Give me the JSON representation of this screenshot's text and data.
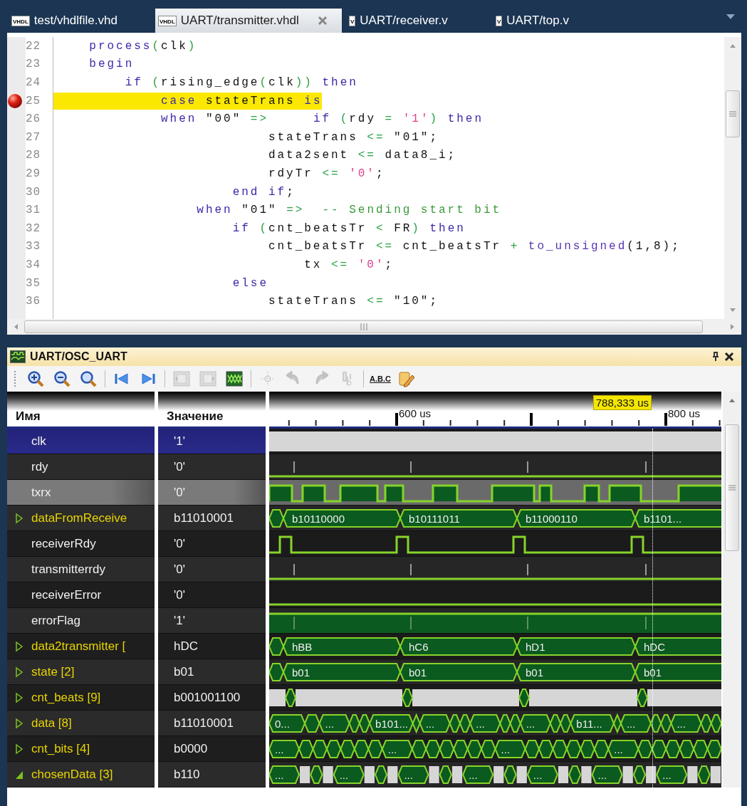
{
  "tabs": [
    {
      "label": "test/vhdlfile.vhd",
      "icon_label": "VHDL",
      "selected": false
    },
    {
      "label": "UART/transmitter.vhdl",
      "icon_label": "VHDL",
      "selected": true
    },
    {
      "label": "UART/receiver.v",
      "icon_label": "V",
      "selected": false
    },
    {
      "label": "UART/top.v",
      "icon_label": "V",
      "selected": false
    }
  ],
  "editor": {
    "lines": [
      {
        "number": "22",
        "breakpoint": false,
        "current": false,
        "tokens": [
          {
            "t": "    process",
            "kind": "kw"
          },
          {
            "t": "(",
            "kind": "op"
          },
          {
            "t": "clk",
            "kind": "id"
          },
          {
            "t": ")",
            "kind": "op"
          }
        ]
      },
      {
        "number": "23",
        "breakpoint": false,
        "current": false,
        "tokens": [
          {
            "t": "    begin",
            "kind": "kw"
          }
        ]
      },
      {
        "number": "24",
        "breakpoint": false,
        "current": false,
        "tokens": [
          {
            "t": "        if ",
            "kind": "kw"
          },
          {
            "t": "(",
            "kind": "op"
          },
          {
            "t": "rising_edge",
            "kind": "id"
          },
          {
            "t": "(",
            "kind": "op"
          },
          {
            "t": "clk",
            "kind": "id"
          },
          {
            "t": ")) ",
            "kind": "op"
          },
          {
            "t": "then",
            "kind": "kw"
          }
        ]
      },
      {
        "number": "25",
        "breakpoint": true,
        "current": true,
        "tokens": [
          {
            "t": "            case ",
            "kind": "kw"
          },
          {
            "t": "stateTrans ",
            "kind": "id"
          },
          {
            "t": "is",
            "kind": "kw"
          }
        ]
      },
      {
        "number": "26",
        "breakpoint": false,
        "current": false,
        "tokens": [
          {
            "t": "            when ",
            "kind": "kw"
          },
          {
            "t": "\"00\" ",
            "kind": "str"
          },
          {
            "t": "=>",
            "kind": "op"
          },
          {
            "t": "     if ",
            "kind": "kw"
          },
          {
            "t": "(",
            "kind": "op"
          },
          {
            "t": "rdy ",
            "kind": "id"
          },
          {
            "t": "= ",
            "kind": "op"
          },
          {
            "t": "'1'",
            "kind": "chr"
          },
          {
            "t": ") ",
            "kind": "op"
          },
          {
            "t": "then",
            "kind": "kw"
          }
        ]
      },
      {
        "number": "27",
        "breakpoint": false,
        "current": false,
        "tokens": [
          {
            "t": "                        stateTrans ",
            "kind": "id"
          },
          {
            "t": "<= ",
            "kind": "op"
          },
          {
            "t": "\"01\";",
            "kind": "str"
          }
        ]
      },
      {
        "number": "28",
        "breakpoint": false,
        "current": false,
        "tokens": [
          {
            "t": "                        data2sent ",
            "kind": "id"
          },
          {
            "t": "<= ",
            "kind": "op"
          },
          {
            "t": "data8_i;",
            "kind": "id"
          }
        ]
      },
      {
        "number": "29",
        "breakpoint": false,
        "current": false,
        "tokens": [
          {
            "t": "                        rdyTr ",
            "kind": "id"
          },
          {
            "t": "<= ",
            "kind": "op"
          },
          {
            "t": "'0'",
            "kind": "chr"
          },
          {
            "t": ";",
            "kind": "id"
          }
        ]
      },
      {
        "number": "30",
        "breakpoint": false,
        "current": false,
        "tokens": [
          {
            "t": "                    end if",
            "kind": "kw"
          },
          {
            "t": ";",
            "kind": "id"
          }
        ]
      },
      {
        "number": "31",
        "breakpoint": false,
        "current": false,
        "tokens": [
          {
            "t": "                when ",
            "kind": "kw"
          },
          {
            "t": "\"01\" ",
            "kind": "str"
          },
          {
            "t": "=>",
            "kind": "op"
          },
          {
            "t": "  -- Sending start bit",
            "kind": "cmt"
          }
        ]
      },
      {
        "number": "32",
        "breakpoint": false,
        "current": false,
        "tokens": [
          {
            "t": "                    if ",
            "kind": "kw"
          },
          {
            "t": "(",
            "kind": "op"
          },
          {
            "t": "cnt_beatsTr ",
            "kind": "id"
          },
          {
            "t": "< ",
            "kind": "op"
          },
          {
            "t": "FR",
            "kind": "id"
          },
          {
            "t": ") ",
            "kind": "op"
          },
          {
            "t": "then",
            "kind": "kw"
          }
        ]
      },
      {
        "number": "33",
        "breakpoint": false,
        "current": false,
        "tokens": [
          {
            "t": "                        cnt_beatsTr ",
            "kind": "id"
          },
          {
            "t": "<= ",
            "kind": "op"
          },
          {
            "t": "cnt_beatsTr ",
            "kind": "id"
          },
          {
            "t": "+ ",
            "kind": "op"
          },
          {
            "t": "to_unsigned",
            "kind": "fn"
          },
          {
            "t": "(1,8);",
            "kind": "id"
          }
        ]
      },
      {
        "number": "34",
        "breakpoint": false,
        "current": false,
        "tokens": [
          {
            "t": "                            tx ",
            "kind": "id"
          },
          {
            "t": "<= ",
            "kind": "op"
          },
          {
            "t": "'0'",
            "kind": "chr"
          },
          {
            "t": ";",
            "kind": "id"
          }
        ]
      },
      {
        "number": "35",
        "breakpoint": false,
        "current": false,
        "tokens": [
          {
            "t": "                    else",
            "kind": "kw"
          }
        ]
      },
      {
        "number": "36",
        "breakpoint": false,
        "current": false,
        "tokens": [
          {
            "t": "                        stateTrans ",
            "kind": "id"
          },
          {
            "t": "<= ",
            "kind": "op"
          },
          {
            "t": "\"10\";",
            "kind": "str"
          }
        ]
      }
    ]
  },
  "waveform_panel": {
    "title": "UART/OSC_UART",
    "toolbar": [
      {
        "kind": "zoom-in",
        "disabled": false
      },
      {
        "kind": "zoom-out",
        "disabled": false
      },
      {
        "kind": "zoom-fit",
        "disabled": false
      },
      {
        "kind": "separator"
      },
      {
        "kind": "first",
        "disabled": false
      },
      {
        "kind": "last",
        "disabled": false
      },
      {
        "kind": "separator"
      },
      {
        "kind": "frame-left",
        "disabled": true
      },
      {
        "kind": "frame-right",
        "disabled": true
      },
      {
        "kind": "wave",
        "disabled": false
      },
      {
        "kind": "separator"
      },
      {
        "kind": "probe",
        "disabled": true
      },
      {
        "kind": "back-arrow",
        "disabled": true
      },
      {
        "kind": "forward-arrow",
        "disabled": true
      },
      {
        "kind": "pin",
        "disabled": true
      },
      {
        "kind": "separator"
      },
      {
        "kind": "text",
        "label": "A.B.C",
        "disabled": false
      },
      {
        "kind": "edit",
        "disabled": false
      }
    ],
    "columns": [
      "Имя",
      "Значение"
    ],
    "ruler": {
      "labels": [
        "600 us",
        "800 us"
      ],
      "cursor": "788,333 us"
    },
    "signals": [
      {
        "name": "clk",
        "value": "'1'",
        "kind": "gray",
        "selected": true,
        "highlighted": false
      },
      {
        "name": "rdy",
        "value": "'0'",
        "kind": "ticks",
        "selected": false,
        "highlighted": false
      },
      {
        "name": "txrx",
        "value": "'0'",
        "kind": "serial",
        "selected": false,
        "highlighted": true
      },
      {
        "name": "dataFromReceive",
        "value": "b11010001",
        "kind": "bus",
        "expanded": false,
        "selected": false,
        "highlighted": false,
        "values": [
          "b10110000",
          "b10111011",
          "b11000110",
          "b1101..."
        ]
      },
      {
        "name": "receiverRdy",
        "value": "'0'",
        "kind": "strobe",
        "selected": false,
        "highlighted": false
      },
      {
        "name": "transmitterrdy",
        "value": "'0'",
        "kind": "ticks",
        "selected": false,
        "highlighted": false
      },
      {
        "name": "receiverError",
        "value": "'0'",
        "kind": "low",
        "selected": false,
        "highlighted": false
      },
      {
        "name": "errorFlag",
        "value": "'1'",
        "kind": "high",
        "selected": false,
        "highlighted": false
      },
      {
        "name": "data2transmitter [",
        "value": "hDC",
        "kind": "bus",
        "expanded": false,
        "selected": false,
        "highlighted": false,
        "values": [
          "hBB",
          "hC6",
          "hD1",
          "hDC"
        ]
      },
      {
        "name": "state [2]",
        "value": "b01",
        "kind": "bus",
        "expanded": false,
        "selected": false,
        "highlighted": false,
        "values": [
          "b01",
          "b01",
          "b01",
          "b01"
        ]
      },
      {
        "name": "cnt_beats [9]",
        "value": "b001001100",
        "kind": "counter",
        "expanded": false,
        "selected": false,
        "highlighted": false
      },
      {
        "name": "data [8]",
        "value": "b11010001",
        "kind": "dense",
        "expanded": false,
        "selected": false,
        "highlighted": false,
        "values": [
          "0...",
          "...",
          "b101...",
          "...",
          "...",
          "...",
          "b11...",
          "...",
          "..."
        ]
      },
      {
        "name": "cnt_bits [4]",
        "value": "b0000",
        "kind": "dense",
        "expanded": false,
        "selected": false,
        "highlighted": false,
        "values": [
          "...",
          "...",
          "...",
          "..."
        ]
      },
      {
        "name": "chosenData [3]",
        "value": "b110",
        "kind": "sparse",
        "expanded": true,
        "selected": false,
        "highlighted": false,
        "values": [
          "...",
          "...",
          "...",
          "...",
          "...",
          "...",
          "..."
        ]
      }
    ]
  }
}
